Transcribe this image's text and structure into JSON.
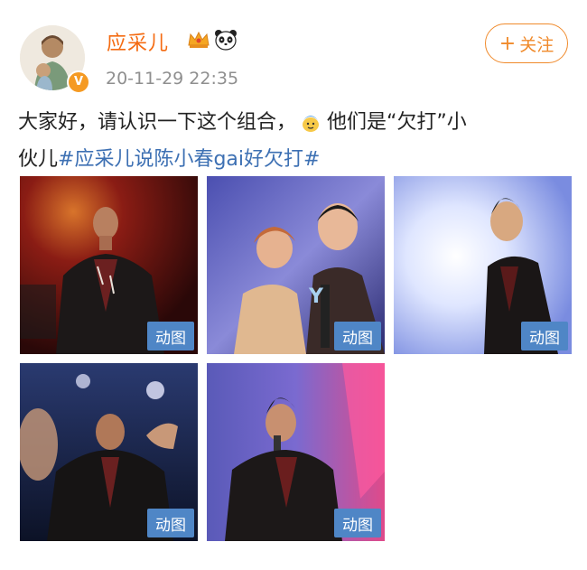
{
  "post": {
    "username": "应采儿",
    "time": "20-11-29 22:35",
    "follow_label": "关注",
    "text_line1": "大家好，请认识一下这个组合，",
    "text_line1b": "他们是“欠打”小",
    "text_line2_plain": "伙儿",
    "hashtag": "#应采儿说陈小春gai好欠打#"
  },
  "media": {
    "gif_label": "动图",
    "items": [
      {
        "label": "动图"
      },
      {
        "label": "动图"
      },
      {
        "label": "动图"
      },
      {
        "label": "动图"
      },
      {
        "label": "动图"
      }
    ]
  },
  "colors": {
    "username": "#f46b12",
    "hashtag": "#3d70b3",
    "follow": "#f08a2b",
    "gif_badge": "#4f86c6"
  }
}
